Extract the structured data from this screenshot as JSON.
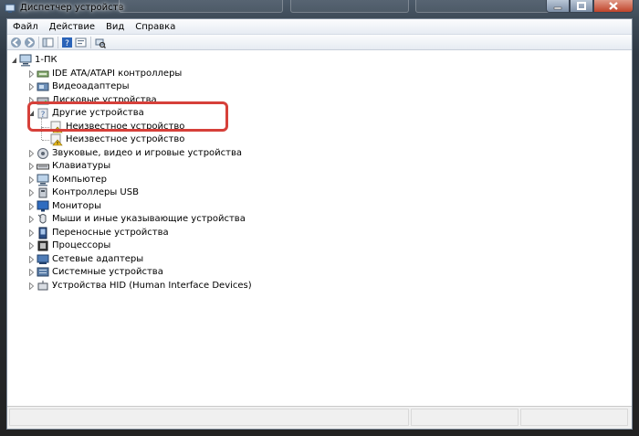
{
  "window": {
    "title": "Диспетчер устройств"
  },
  "menubar": {
    "items": [
      "Файл",
      "Действие",
      "Вид",
      "Справка"
    ]
  },
  "toolbar": {
    "icons": [
      "back-icon",
      "forward-icon",
      "show-hide-tree-icon",
      "help-icon",
      "properties-icon",
      "scan-hardware-icon"
    ]
  },
  "tree": {
    "root": "1-ПК",
    "categories": [
      {
        "label": "IDE ATA/ATAPI контроллеры",
        "icon": "ide-controller-icon",
        "expanded": false
      },
      {
        "label": "Видеоадаптеры",
        "icon": "display-adapter-icon",
        "expanded": false
      },
      {
        "label": "Дисковые устройства",
        "icon": "disk-drive-icon",
        "expanded": false
      },
      {
        "label": "Другие устройства",
        "icon": "other-devices-icon",
        "expanded": true,
        "children": [
          {
            "label": "Неизвестное устройство",
            "icon": "unknown-device-warning-icon"
          },
          {
            "label": "Неизвестное устройство",
            "icon": "unknown-device-warning-icon"
          }
        ]
      },
      {
        "label": "Звуковые, видео и игровые устройства",
        "icon": "sound-device-icon",
        "expanded": false
      },
      {
        "label": "Клавиатуры",
        "icon": "keyboard-icon",
        "expanded": false
      },
      {
        "label": "Компьютер",
        "icon": "computer-icon",
        "expanded": false
      },
      {
        "label": "Контроллеры USB",
        "icon": "usb-controller-icon",
        "expanded": false
      },
      {
        "label": "Мониторы",
        "icon": "monitor-icon",
        "expanded": false
      },
      {
        "label": "Мыши и иные указывающие устройства",
        "icon": "mouse-icon",
        "expanded": false
      },
      {
        "label": "Переносные устройства",
        "icon": "portable-device-icon",
        "expanded": false
      },
      {
        "label": "Процессоры",
        "icon": "processor-icon",
        "expanded": false
      },
      {
        "label": "Сетевые адаптеры",
        "icon": "network-adapter-icon",
        "expanded": false
      },
      {
        "label": "Системные устройства",
        "icon": "system-device-icon",
        "expanded": false
      },
      {
        "label": "Устройства HID (Human Interface Devices)",
        "icon": "hid-device-icon",
        "expanded": false
      }
    ]
  },
  "colors": {
    "highlight_border": "#d6403a",
    "warning": "#f0c020"
  }
}
